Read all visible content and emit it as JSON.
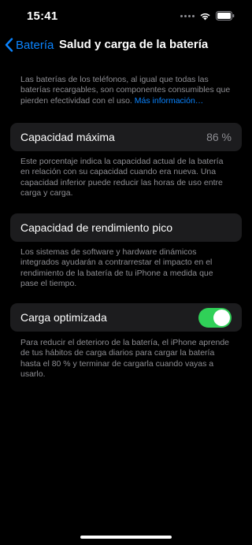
{
  "status_bar": {
    "time": "15:41",
    "icons": [
      "signal-dots-icon",
      "wifi-icon",
      "battery-icon"
    ],
    "battery_level": 1.0
  },
  "nav": {
    "back_label": "Batería",
    "title": "Salud y carga de la batería",
    "back_icon": "chevron-left-icon"
  },
  "intro": {
    "text": "Las baterías de los teléfonos, al igual que todas las baterías recargables, son componentes consumibles que pierden efectividad con el uso.",
    "link": "Más información…"
  },
  "max_capacity": {
    "label": "Capacidad máxima",
    "value": "86 %",
    "description": "Este porcentaje indica la capacidad actual de la batería en relación con su capacidad cuando era nueva. Una capacidad inferior puede reducir las horas de uso entre carga y carga."
  },
  "peak_performance": {
    "label": "Capacidad de rendimiento pico",
    "description": "Los sistemas de software y hardware dinámicos integrados ayudarán a contrarrestar el impacto en el rendimiento de la batería de tu iPhone a medida que pase el tiempo."
  },
  "optimized_charging": {
    "label": "Carga optimizada",
    "enabled": true,
    "description": "Para reducir el deterioro de la batería, el iPhone aprende de tus hábitos de carga diarios para cargar la batería hasta el 80 % y terminar de cargarla cuando vayas a usarlo."
  },
  "colors": {
    "background": "#000000",
    "card": "#1c1c1e",
    "accent": "#0a84ff",
    "toggle_on": "#30d158",
    "secondary_text": "#8e8e93"
  }
}
